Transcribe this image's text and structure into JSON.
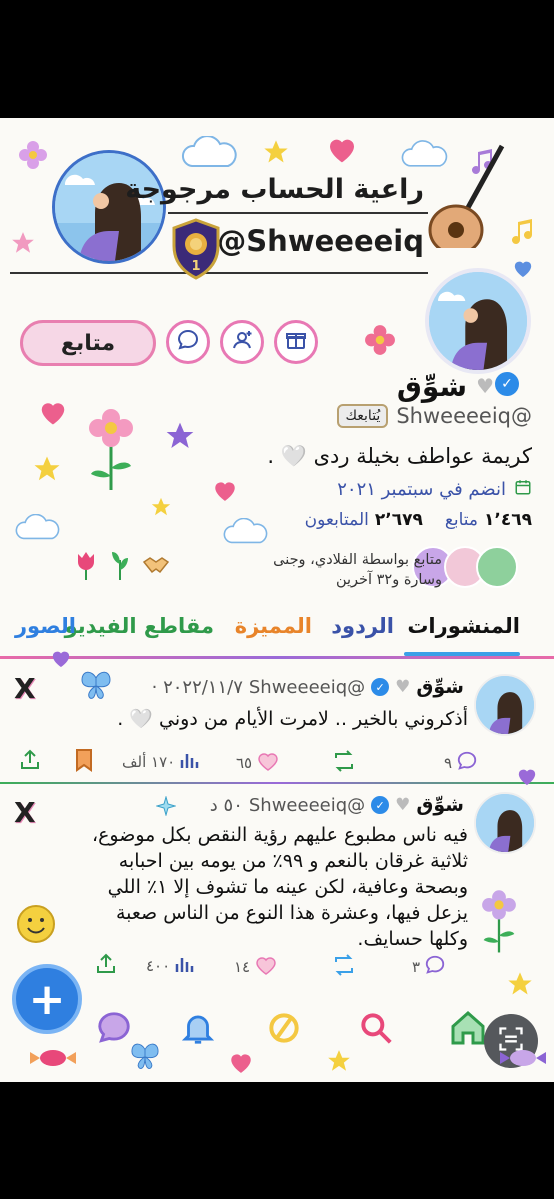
{
  "banner": {
    "title": "راعية الحساب مرجوجة",
    "handle": "@Shweeeeiq",
    "badge_digit": "1"
  },
  "profile": {
    "name": "شوِّق",
    "handle": "@Shweeeeiq",
    "follows_you": "يُتابعك",
    "bio": "كريمة عواطف بخيلة ردى 🤍 .",
    "joined": "انضم في سبتمبر ٢٠٢١",
    "following_count": "١٬٤٦٩",
    "following_label": "متابع",
    "followers_count": "٢٬٦٧٩",
    "followers_label": "المتابعون",
    "followed_by": "متابع بواسطة الفلادي، وجنى وسارة و٣٢ آخرين",
    "follow_button": "متابع"
  },
  "tabs": [
    {
      "label": "المنشورات",
      "color": "#111111"
    },
    {
      "label": "الردود",
      "color": "#3a52a8"
    },
    {
      "label": "المميزة",
      "color": "#e8842a"
    },
    {
      "label": "مقاطع الفيديو",
      "color": "#2f9a4a"
    },
    {
      "label": "الصور",
      "color": "#2f7fe0"
    }
  ],
  "posts": [
    {
      "name": "شوِّق",
      "handle": "@Shweeeeiq",
      "date": "٢٠٢٢/١١/٧ ·",
      "text": "أذكروني بالخير .. لامرت الأيام من دوني 🤍 .",
      "replies": "٩",
      "reposts": "",
      "likes": "٦٥",
      "views": "١٧٠ ألف"
    },
    {
      "name": "شوِّق",
      "handle": "@Shweeeeiq",
      "date": "٥٠ د",
      "text": "فيه ناس مطبوع عليهم رؤية النقص بكل موضوع، ثلاثية غرقان بالنعم و ٩٩٪ من يومه بين احبابه وبصحة وعافية، لكن عينه ما تشوف إلا ١٪ اللي يزعل فيها، وعشرة هذا النوع من الناس صعبة وكلها حسايف.",
      "replies": "٣",
      "reposts": "",
      "likes": "١٤",
      "views": "٤٠٠"
    }
  ],
  "icons": {
    "follow_icon_1": "gift-icon",
    "follow_icon_2": "add-person-icon",
    "follow_icon_3": "message-icon"
  },
  "colors": {
    "accent_blue": "#2f7fe0",
    "pink": "#e878b4",
    "verified": "#2c8be8"
  }
}
